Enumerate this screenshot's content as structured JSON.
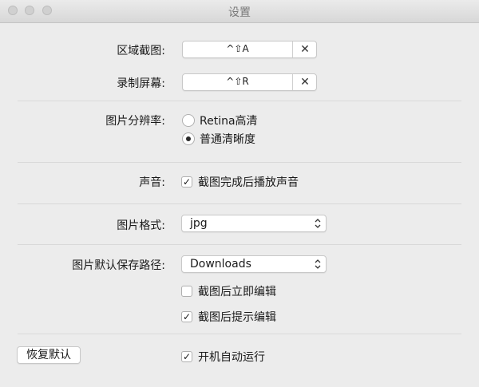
{
  "window": {
    "title": "设置"
  },
  "shortcuts": {
    "area_capture": {
      "label": "区域截图:",
      "value": "^⇧A",
      "clear_label": "✕"
    },
    "screen_record": {
      "label": "录制屏幕:",
      "value": "^⇧R",
      "clear_label": "✕"
    }
  },
  "resolution": {
    "label": "图片分辨率:",
    "options": [
      {
        "label": "Retina高清",
        "selected": false
      },
      {
        "label": "普通清晰度",
        "selected": true
      }
    ]
  },
  "sound": {
    "label": "声音:",
    "option": {
      "label": "截图完成后播放声音",
      "checked": true
    }
  },
  "format": {
    "label": "图片格式:",
    "value": "jpg"
  },
  "save_path": {
    "label": "图片默认保存路径:",
    "value": "Downloads",
    "options": [
      {
        "label": "截图后立即编辑",
        "checked": false
      },
      {
        "label": "截图后提示编辑",
        "checked": true
      }
    ]
  },
  "footer": {
    "restore_label": "恢复默认",
    "autostart": {
      "label": "开机自动运行",
      "checked": true
    }
  },
  "check_glyph": "✓"
}
